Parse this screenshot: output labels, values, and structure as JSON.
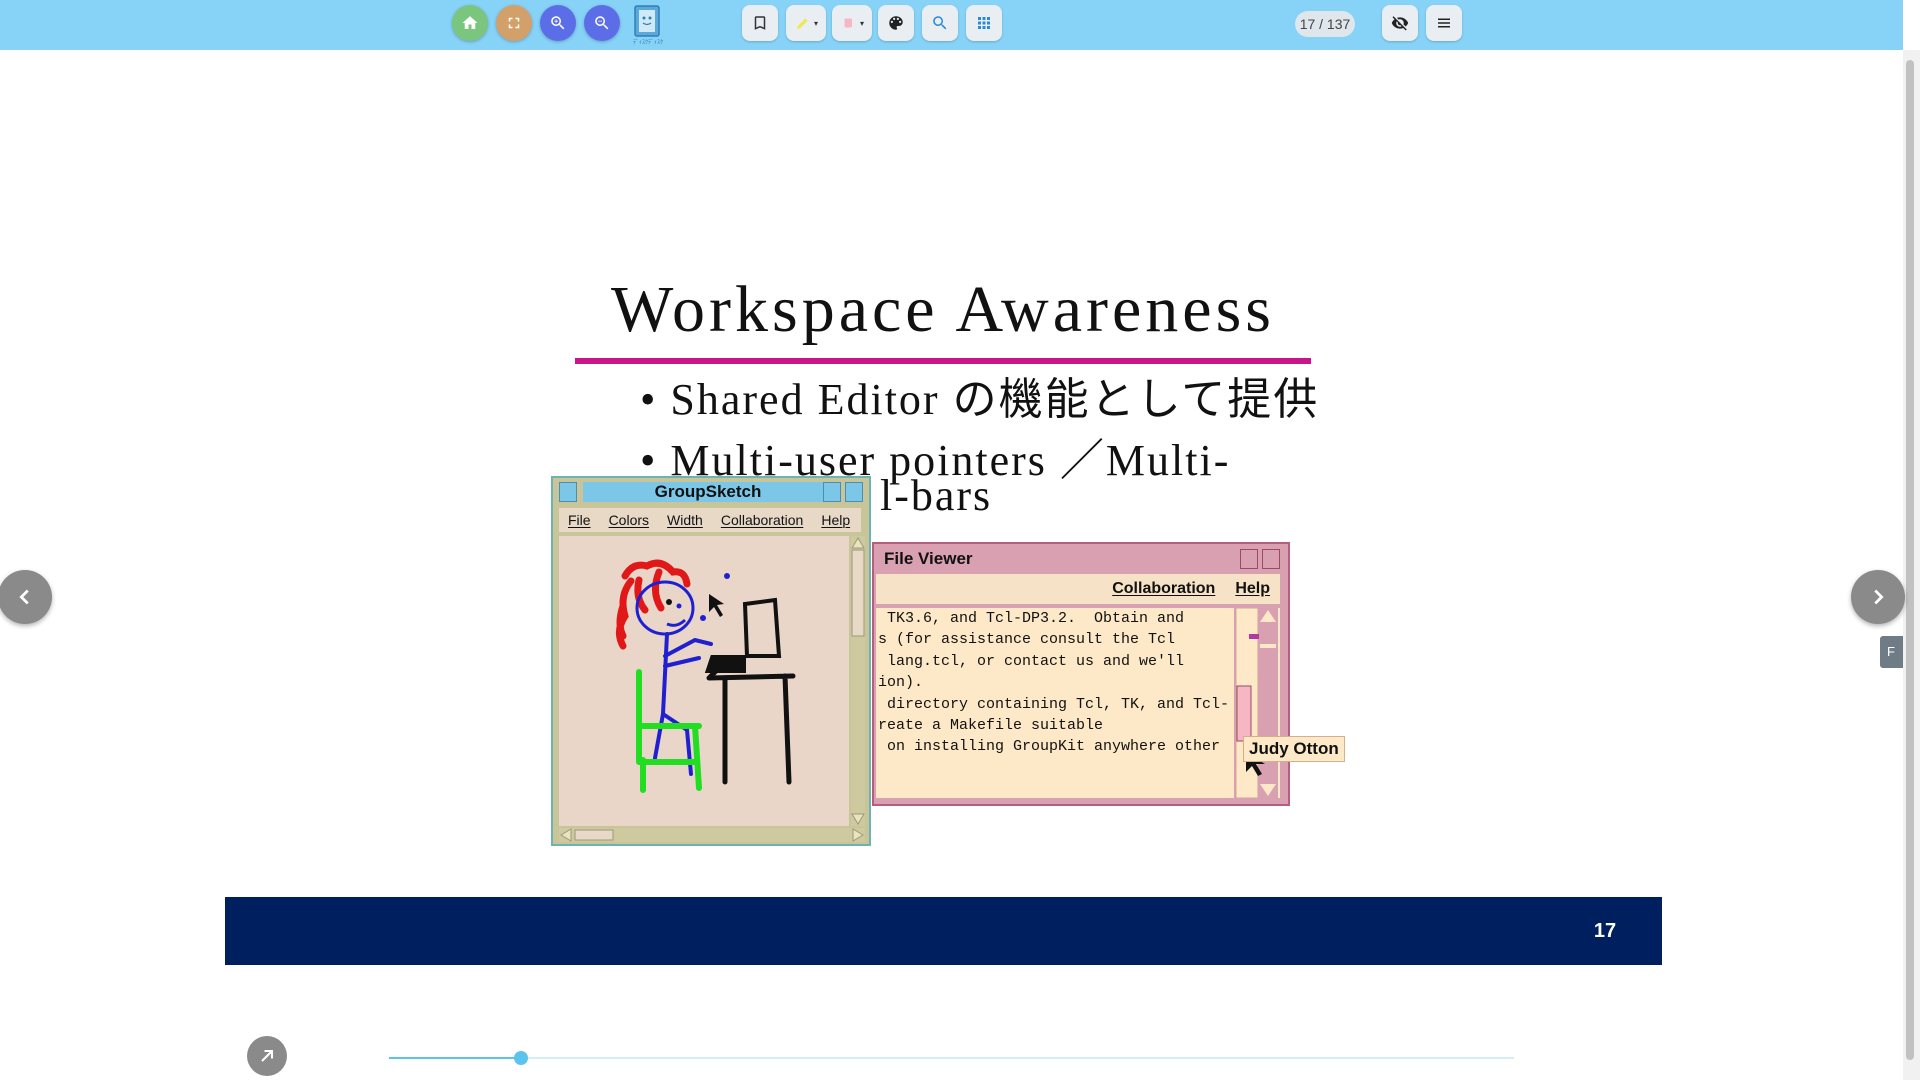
{
  "toolbar": {
    "page_counter": "17 / 137",
    "logo_caption": "ﾃﾞｨｽｸﾃﾞｨｽｸ",
    "buttons": [
      {
        "name": "home-icon",
        "color": "#7bc67e"
      },
      {
        "name": "fullscreen-icon",
        "color": "#d4a06a"
      },
      {
        "name": "zoom-in-icon",
        "color": "#5b6ee8"
      },
      {
        "name": "zoom-out-icon",
        "color": "#5b6ee8"
      }
    ]
  },
  "slide": {
    "title": "Workspace Awareness",
    "bullets": [
      "• Shared Editor の機能として提供",
      "• Multi-user pointers ／Multi-",
      "l-bars"
    ],
    "page_number": "17",
    "accent_color": "#c8158c",
    "footer_color": "#001f5f"
  },
  "groupsketch": {
    "title": "GroupSketch",
    "menu": [
      "File",
      "Colors",
      "Width",
      "Collaboration",
      "Help"
    ]
  },
  "file_viewer": {
    "title": "File Viewer",
    "menu": [
      "Collaboration",
      "Help"
    ],
    "lines": [
      " TK3.6, and Tcl-DP3.2.  Obtain and",
      "s (for assistance consult the Tcl",
      " lang.tcl, or contact us and we'll",
      "ion).",
      "",
      " directory containing Tcl, TK, and Tcl-",
      "reate a Makefile suitable",
      " on installing GroupKit anywhere other"
    ],
    "user_label": "Judy Otton"
  },
  "side_tab_label": "F",
  "progress": {
    "fraction": 0.117
  }
}
